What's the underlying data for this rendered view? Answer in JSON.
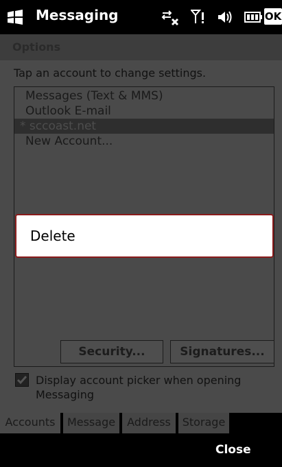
{
  "titlebar": {
    "app_title": "Messaging",
    "ok_label": "OK",
    "icons": [
      "windows-start-icon",
      "sync-icon",
      "signal-icon",
      "volume-icon",
      "battery-icon"
    ]
  },
  "options": {
    "header": "Options",
    "instruction": "Tap an account to change settings.",
    "accounts": [
      "Messages (Text & MMS)",
      "Outlook E-mail",
      "* sccoast.net",
      "New Account..."
    ],
    "security_button": "Security...",
    "signatures_button": "Signatures...",
    "checkbox_label": "Display account picker when opening Messaging",
    "checkbox_checked": true
  },
  "tabs": [
    "Accounts",
    "Message",
    "Address",
    "Storage"
  ],
  "softkeys": {
    "right": "Close"
  },
  "context_menu": {
    "items": [
      "Delete"
    ]
  },
  "colors": {
    "accent_border": "#8a1b1b"
  }
}
